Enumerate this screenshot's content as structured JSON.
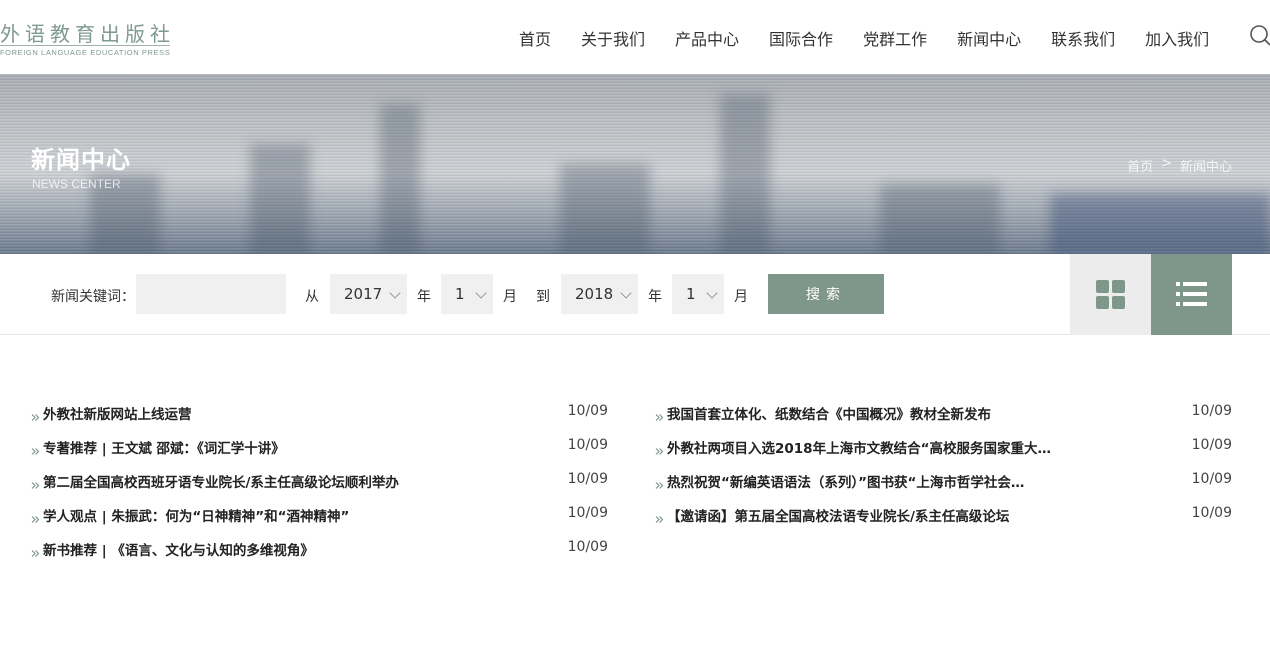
{
  "logo": {
    "cn": "外语教育出版社",
    "en": "FOREIGN LANGUAGE EDUCATION PRESS"
  },
  "nav": [
    "首页",
    "关于我们",
    "产品中心",
    "国际合作",
    "党群工作",
    "新闻中心",
    "联系我们",
    "加入我们"
  ],
  "icons": {
    "search": "search-icon",
    "grid": "grid-view-icon",
    "list": "list-view-icon",
    "bullet": "double-chevron-right-icon"
  },
  "banner": {
    "title": "新闻中心",
    "subtitle": "NEWS CENTER",
    "breadcrumb": [
      "首页",
      ">",
      "新闻中心"
    ]
  },
  "filter": {
    "keyword_label": "新闻关键词：",
    "keyword_value": "",
    "from_label": "从",
    "year_unit": "年",
    "month_unit": "月",
    "to_label": "到",
    "from_year": "2017",
    "from_month": "1",
    "to_year": "2018",
    "to_month": "1",
    "search_label": "搜索"
  },
  "colors": {
    "accent": "#7f968b",
    "logo": "#7f9a8e",
    "field_bg": "#f0f0f0"
  },
  "news": {
    "left": [
      {
        "title": "外教社新版网站上线运营",
        "date": "10/09"
      },
      {
        "title": "专著推荐 | 王文斌 邵斌：《词汇学十讲》",
        "date": "10/09"
      },
      {
        "title": "第二届全国高校西班牙语专业院长/系主任高级论坛顺利举办",
        "date": "10/09"
      },
      {
        "title": "学人观点 | 朱振武：何为“日神精神”和“酒神精神”",
        "date": "10/09"
      },
      {
        "title": "新书推荐 | 《语言、文化与认知的多维视角》",
        "date": "10/09"
      }
    ],
    "right": [
      {
        "title": "我国首套立体化、纸数结合《中国概况》教材全新发布",
        "date": "10/09"
      },
      {
        "title": "外教社两项目入选2018年上海市文教结合“高校服务国家重大…",
        "date": "10/09"
      },
      {
        "title": "热烈祝贺“新编英语语法（系列）”图书获“上海市哲学社会…",
        "date": "10/09"
      },
      {
        "title": "【邀请函】第五届全国高校法语专业院长/系主任高级论坛",
        "date": "10/09"
      }
    ]
  }
}
